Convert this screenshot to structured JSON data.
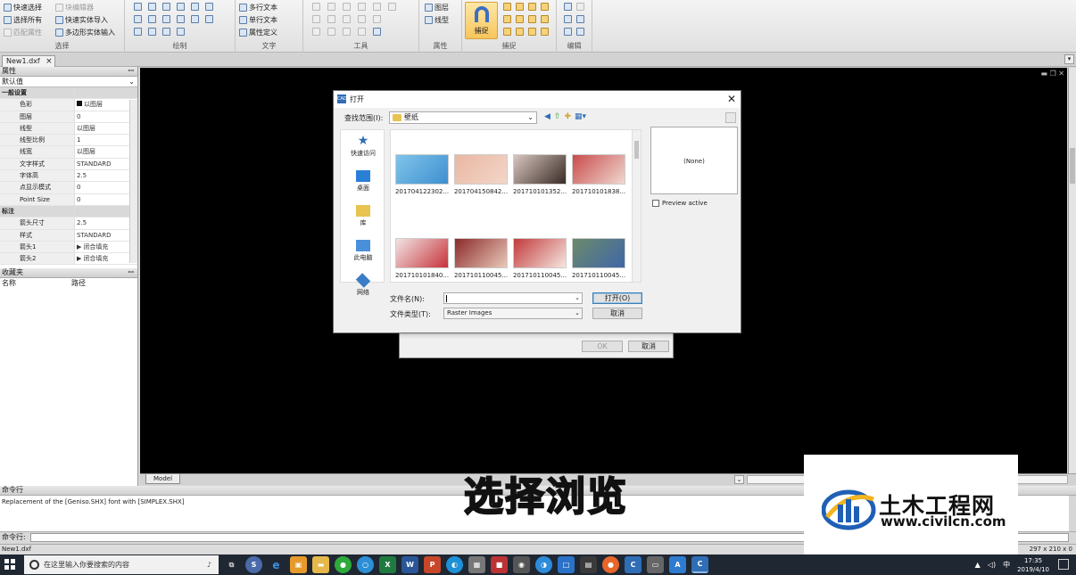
{
  "ribbon": {
    "select": {
      "quick_select": "快速选择",
      "block_editor": "块编辑器",
      "select_all": "选择所有",
      "quick_import": "快速实体导入",
      "match_prop": "匹配属性",
      "poly_input": "多边形实体输入",
      "title": "选择"
    },
    "draw": {
      "title": "绘制"
    },
    "text": {
      "mtext": "多行文本",
      "stext": "单行文本",
      "attdef": "属性定义",
      "title": "文字"
    },
    "tools": {
      "title": "工具"
    },
    "props": {
      "layer": "图层",
      "linetype": "线型",
      "title": "属性"
    },
    "snap": {
      "button": "捕捉",
      "title": "捕捉"
    },
    "edit": {
      "title": "编辑"
    }
  },
  "doc_tab": "New1.dxf",
  "props_panel": {
    "title": "属性",
    "filter": "默认值",
    "rows": [
      {
        "k": "一般设置",
        "v": "",
        "cat": true
      },
      {
        "k": "色彩",
        "v": "以图层",
        "swatch": true
      },
      {
        "k": "图层",
        "v": "0"
      },
      {
        "k": "线型",
        "v": "以图层"
      },
      {
        "k": "线型比例",
        "v": "1"
      },
      {
        "k": "线宽",
        "v": "以图层"
      },
      {
        "k": "文字样式",
        "v": "STANDARD"
      },
      {
        "k": "字体高",
        "v": "2.5"
      },
      {
        "k": "点显示模式",
        "v": "0"
      },
      {
        "k": "Point Size",
        "v": "0"
      },
      {
        "k": "标注",
        "v": "",
        "cat": true
      },
      {
        "k": "箭头尺寸",
        "v": "2.5"
      },
      {
        "k": "样式",
        "v": "STANDARD"
      },
      {
        "k": "箭头1",
        "v": "闭合填充",
        "arrow": true
      },
      {
        "k": "箭头2",
        "v": "闭合填充",
        "arrow": true
      }
    ]
  },
  "favorites": {
    "title": "收藏夹",
    "col_name": "名称",
    "col_path": "路径"
  },
  "model_tab": "Model",
  "command": {
    "title": "命令行",
    "history": "Replacement of the [Geniso.SHX] font with [SIMPLEX.SHX]",
    "prompt": "命令行:"
  },
  "status": {
    "file": "New1.dxf",
    "dims": "297 x 210 x 0"
  },
  "dialog": {
    "title": "打开",
    "look_in_label": "查找范围(I):",
    "look_in_value": "壁纸",
    "places": [
      "快速访问",
      "桌面",
      "库",
      "此电脑",
      "网络"
    ],
    "files": [
      "201704122302...",
      "201704150842...",
      "201710101352...",
      "201710101838...",
      "201710101840...",
      "201710110045...",
      "201710110045...",
      "201710110045..."
    ],
    "preview_text": "(None)",
    "preview_active": "Preview active",
    "filename_label": "文件名(N):",
    "filename_value": "",
    "filetype_label": "文件类型(T):",
    "filetype_value": "Raster Images",
    "open_button": "打开(O)",
    "cancel_button": "取消"
  },
  "behind_dialog": {
    "ok": "OK",
    "cancel": "取消"
  },
  "subtitle": "选择浏览",
  "watermark": {
    "title": "土木工程网",
    "url": "www.civilcn.com"
  },
  "taskbar": {
    "search_placeholder": "在这里输入你要搜索的内容",
    "time": "17:35",
    "date": "2019/4/10",
    "lang": "中"
  },
  "colors": {
    "canvas": "#000000",
    "snap_bg": "#f7c55c",
    "taskbar": "#1f2733"
  }
}
